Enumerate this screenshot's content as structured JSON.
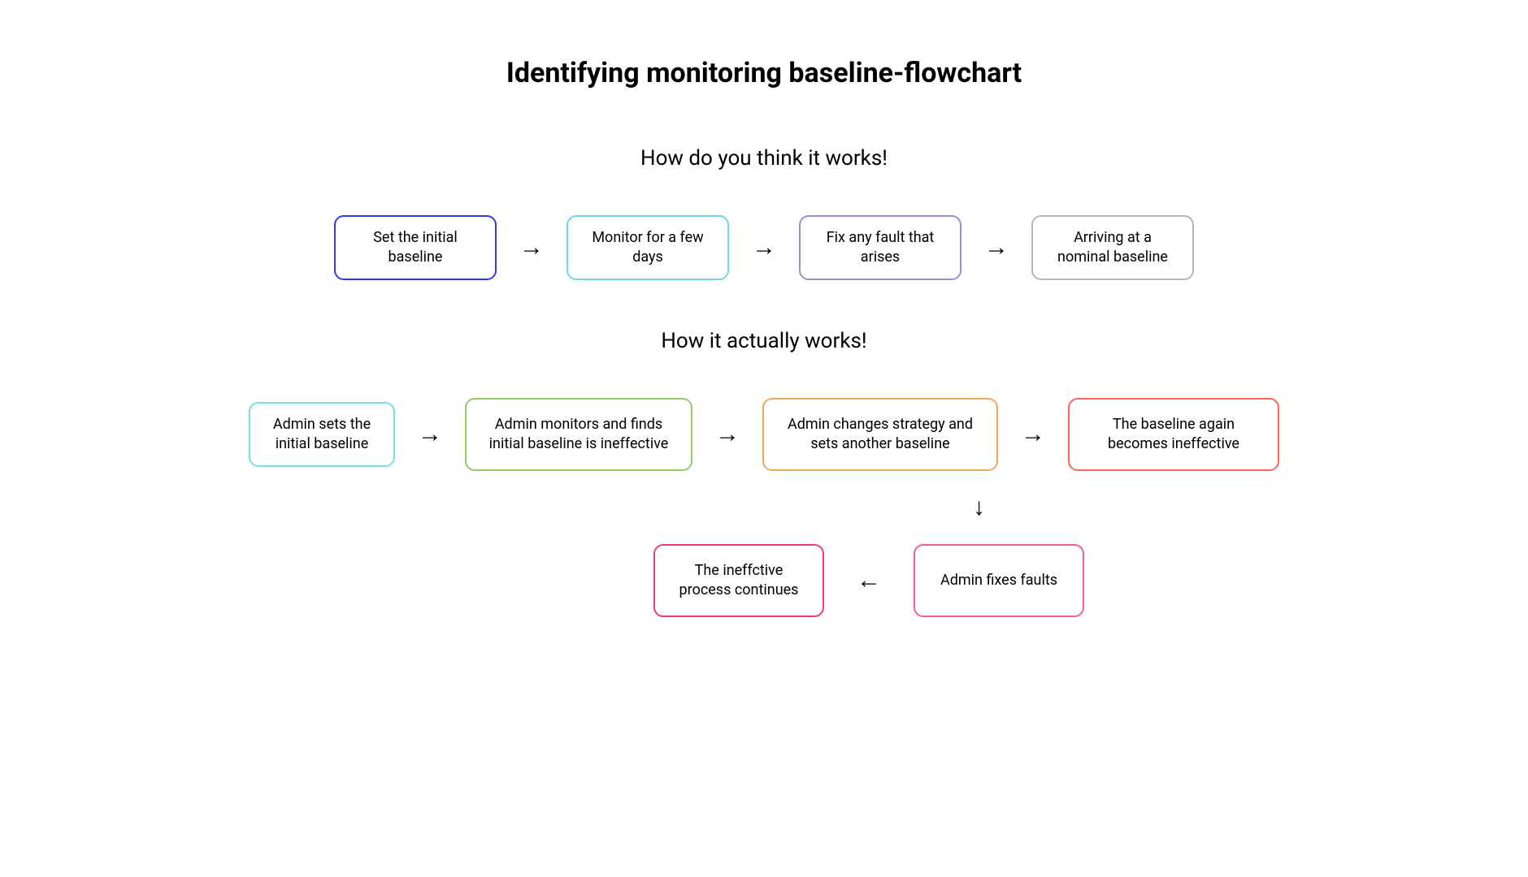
{
  "title": "Identifying monitoring baseline-flowchart",
  "section1_title": "How do you think it works!",
  "section2_title": "How it actually works!",
  "row1": {
    "step1": "Set the initial baseline",
    "step2": "Monitor for a few days",
    "step3": "Fix any fault that arises",
    "step4": "Arriving at a nominal baseline"
  },
  "row2": {
    "step1": "Admin sets the initial baseline",
    "step2": "Admin monitors and finds initial baseline is ineffective",
    "step3": "Admin changes strategy and sets another baseline",
    "step4": "The baseline again becomes ineffective",
    "step5": "Admin fixes faults",
    "step6": "The ineffctive process continues"
  },
  "arrows": {
    "right": "→",
    "down": "↓",
    "left": "←"
  }
}
